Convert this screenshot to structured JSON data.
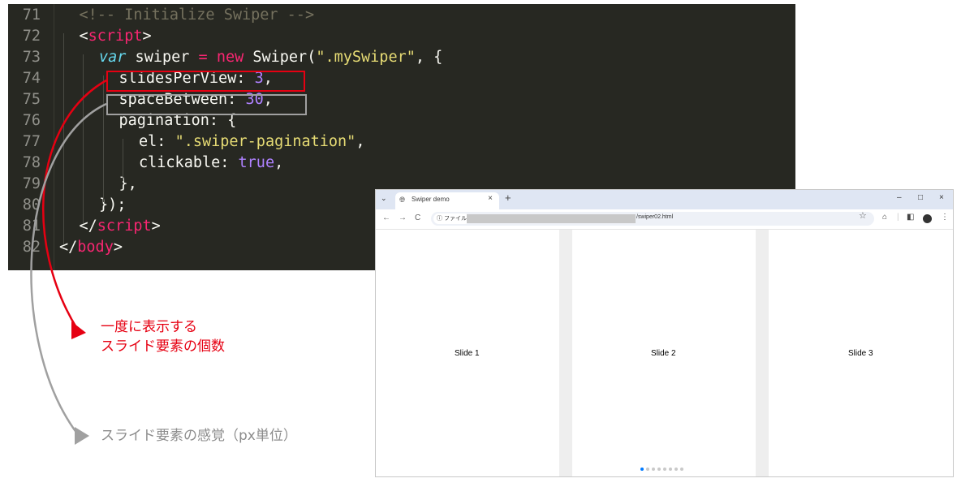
{
  "editor": {
    "lines": [
      {
        "n": "71",
        "tokens": [
          {
            "c": "t-com",
            "t": "<!-- Initialize Swiper -->"
          }
        ]
      },
      {
        "n": "72",
        "tokens": [
          {
            "c": "t-ang",
            "t": "<"
          },
          {
            "c": "t-tag",
            "t": "script"
          },
          {
            "c": "t-ang",
            "t": ">"
          }
        ]
      },
      {
        "n": "73",
        "tokens": [
          {
            "c": "t-var",
            "t": "var"
          },
          {
            "c": "t-pl",
            "t": " swiper "
          },
          {
            "c": "t-kw",
            "t": "="
          },
          {
            "c": "t-pl",
            "t": " "
          },
          {
            "c": "t-kw",
            "t": "new"
          },
          {
            "c": "t-pl",
            "t": " Swiper("
          },
          {
            "c": "t-str",
            "t": "\".mySwiper\""
          },
          {
            "c": "t-pl",
            "t": ", {"
          }
        ]
      },
      {
        "n": "74",
        "tokens": [
          {
            "c": "t-pl",
            "t": "slidesPerView: "
          },
          {
            "c": "t-num",
            "t": "3"
          },
          {
            "c": "t-pl",
            "t": ","
          }
        ]
      },
      {
        "n": "75",
        "tokens": [
          {
            "c": "t-pl",
            "t": "spaceBetween: "
          },
          {
            "c": "t-num",
            "t": "30"
          },
          {
            "c": "t-pl",
            "t": ","
          }
        ]
      },
      {
        "n": "76",
        "tokens": [
          {
            "c": "t-pl",
            "t": "pagination: {"
          }
        ]
      },
      {
        "n": "77",
        "tokens": [
          {
            "c": "t-pl",
            "t": "el: "
          },
          {
            "c": "t-str",
            "t": "\".swiper-pagination\""
          },
          {
            "c": "t-pl",
            "t": ","
          }
        ]
      },
      {
        "n": "78",
        "tokens": [
          {
            "c": "t-pl",
            "t": "clickable: "
          },
          {
            "c": "t-bool",
            "t": "true"
          },
          {
            "c": "t-pl",
            "t": ","
          }
        ]
      },
      {
        "n": "79",
        "tokens": [
          {
            "c": "t-pl",
            "t": "},"
          }
        ]
      },
      {
        "n": "80",
        "tokens": [
          {
            "c": "t-pl",
            "t": "});"
          }
        ]
      },
      {
        "n": "81",
        "tokens": [
          {
            "c": "t-ang",
            "t": "</"
          },
          {
            "c": "t-tag",
            "t": "script"
          },
          {
            "c": "t-ang",
            "t": ">"
          }
        ]
      },
      {
        "n": "82",
        "tokens": [
          {
            "c": "t-ang",
            "t": "</"
          },
          {
            "c": "t-tag",
            "t": "body"
          },
          {
            "c": "t-ang",
            "t": ">"
          }
        ]
      }
    ],
    "colors": {
      "background": "#272822",
      "highlight_red": "#e60012",
      "highlight_gray": "#a0a0a0"
    }
  },
  "annotations": {
    "red_line1": "一度に表示する",
    "red_line2": "スライド要素の個数",
    "gray": "スライド要素の感覚（px単位）"
  },
  "browser": {
    "tab_title": "Swiper demo",
    "tab_icon": "globe-icon",
    "new_tab": "+",
    "tab_close": "×",
    "window_controls": {
      "minimize": "–",
      "maximize": "□",
      "close": "×"
    },
    "nav": {
      "back": "←",
      "forward": "→",
      "reload": "C"
    },
    "site_info_chip": "ⓘ ファイル",
    "url_path": "/swiper02.html",
    "slides": [
      "Slide 1",
      "Slide 2",
      "Slide 3"
    ],
    "pagination": {
      "count": 8,
      "active_index": 0
    },
    "accent_color": "#007aff"
  }
}
